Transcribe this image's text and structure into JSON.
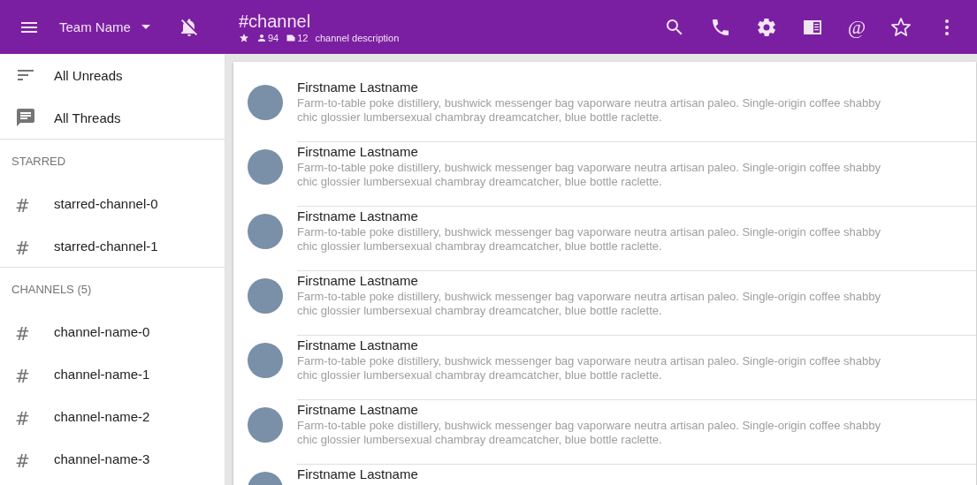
{
  "header": {
    "team_name": "Team Name",
    "notifications_muted": true,
    "channel_title": "#channel",
    "starred": true,
    "member_count": "94",
    "file_count": "12",
    "description": "channel description",
    "mention_symbol": "@"
  },
  "sidebar": {
    "nav": [
      {
        "kind": "unreads",
        "label": "All Unreads"
      },
      {
        "kind": "threads",
        "label": "All Threads"
      }
    ],
    "sections": [
      {
        "title": "STARRED",
        "items": [
          {
            "prefix": "#",
            "label": "starred-channel-0"
          },
          {
            "prefix": "#",
            "label": "starred-channel-1"
          }
        ]
      },
      {
        "title": "CHANNELS (5)",
        "items": [
          {
            "prefix": "#",
            "label": "channel-name-0"
          },
          {
            "prefix": "#",
            "label": "channel-name-1"
          },
          {
            "prefix": "#",
            "label": "channel-name-2"
          },
          {
            "prefix": "#",
            "label": "channel-name-3"
          }
        ]
      }
    ]
  },
  "messages": [
    {
      "author": "Firstname Lastname",
      "body": "Farm-to-table poke distillery, bushwick messenger bag vaporware neutra artisan paleo. Single-origin coffee shabby chic glossier lumbersexual chambray dreamcatcher, blue bottle raclette."
    },
    {
      "author": "Firstname Lastname",
      "body": "Farm-to-table poke distillery, bushwick messenger bag vaporware neutra artisan paleo. Single-origin coffee shabby chic glossier lumbersexual chambray dreamcatcher, blue bottle raclette."
    },
    {
      "author": "Firstname Lastname",
      "body": "Farm-to-table poke distillery, bushwick messenger bag vaporware neutra artisan paleo. Single-origin coffee shabby chic glossier lumbersexual chambray dreamcatcher, blue bottle raclette."
    },
    {
      "author": "Firstname Lastname",
      "body": "Farm-to-table poke distillery, bushwick messenger bag vaporware neutra artisan paleo. Single-origin coffee shabby chic glossier lumbersexual chambray dreamcatcher, blue bottle raclette."
    },
    {
      "author": "Firstname Lastname",
      "body": "Farm-to-table poke distillery, bushwick messenger bag vaporware neutra artisan paleo. Single-origin coffee shabby chic glossier lumbersexual chambray dreamcatcher, blue bottle raclette."
    },
    {
      "author": "Firstname Lastname",
      "body": "Farm-to-table poke distillery, bushwick messenger bag vaporware neutra artisan paleo. Single-origin coffee shabby chic glossier lumbersexual chambray dreamcatcher, blue bottle raclette."
    },
    {
      "author": "Firstname Lastname"
    }
  ]
}
